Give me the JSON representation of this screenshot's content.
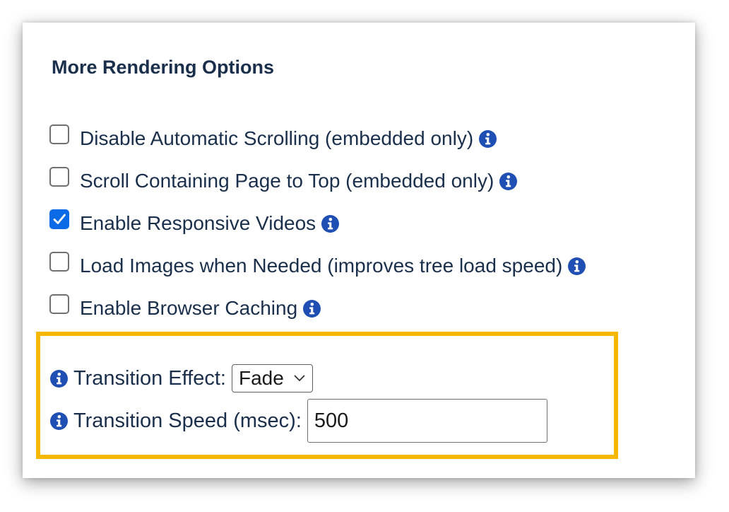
{
  "section": {
    "title": "More Rendering Options"
  },
  "options": [
    {
      "label": "Disable Automatic Scrolling (embedded only)",
      "checked": false,
      "icon": "info-icon"
    },
    {
      "label": "Scroll Containing Page to Top (embedded only)",
      "checked": false,
      "icon": "info-icon"
    },
    {
      "label": "Enable Responsive Videos",
      "checked": true,
      "icon": "info-icon"
    },
    {
      "label": "Load Images when Needed (improves tree load speed)",
      "checked": false,
      "icon": "info-icon"
    },
    {
      "label": "Enable Browser Caching",
      "checked": false,
      "icon": "info-icon"
    }
  ],
  "transition": {
    "effect_label": "Transition Effect:",
    "effect_value": "Fade",
    "speed_label": "Transition Speed (msec):",
    "speed_value": "500"
  },
  "colors": {
    "text": "#1a2f4b",
    "info_icon": "#1f4fb3",
    "checkbox_checked": "#0b6be6",
    "highlight_border": "#f5b700"
  }
}
